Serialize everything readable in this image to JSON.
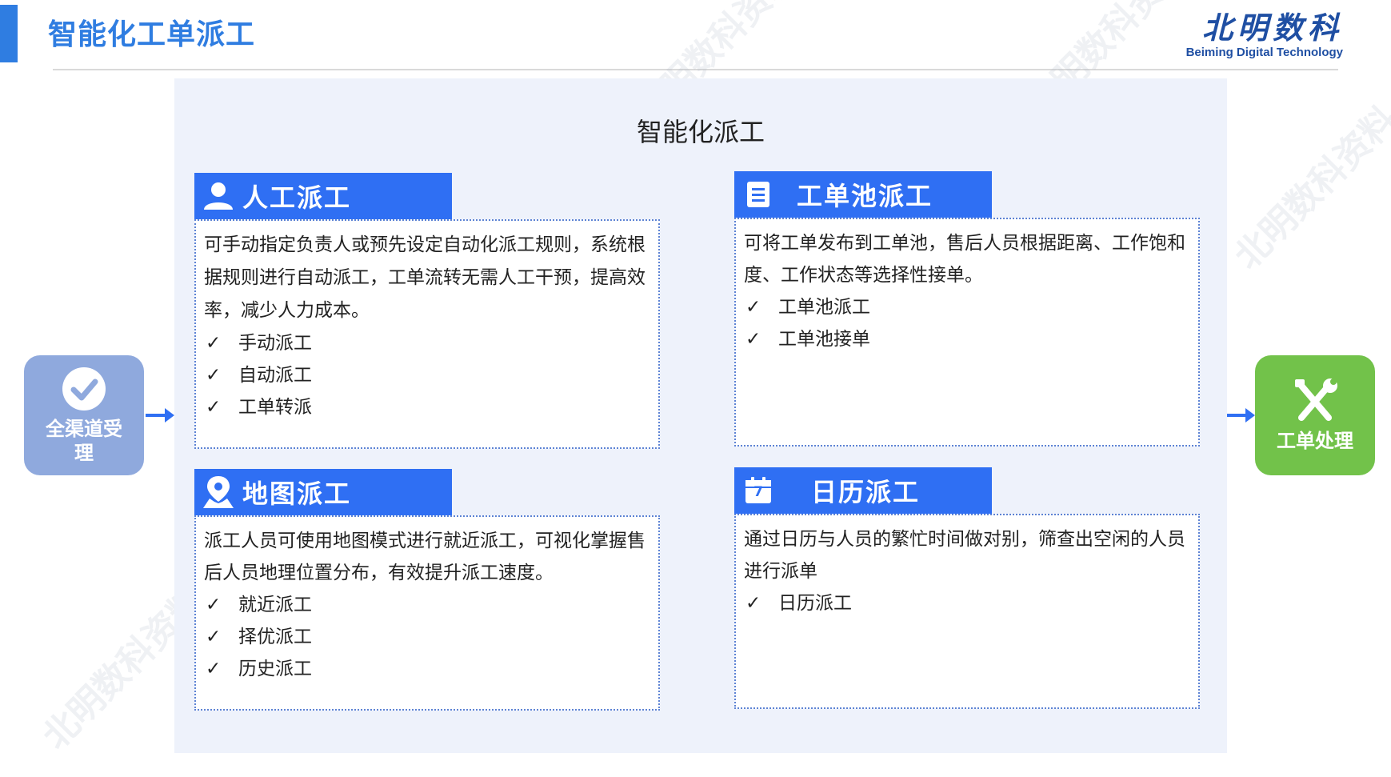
{
  "page": {
    "title": "智能化工单派工"
  },
  "logo": {
    "mark": "北明数科",
    "subtitle": "Beiming Digital Technology"
  },
  "panel": {
    "title": "智能化派工"
  },
  "left_node": {
    "label": "全渠道受理",
    "icon": "check-circle-icon",
    "color": "#8fa9dd"
  },
  "right_node": {
    "label": "工单处理",
    "icon": "wrench-screwdriver-icon",
    "color": "#72c24a"
  },
  "sections": {
    "manual": {
      "title": "人工派工",
      "icon": "person-icon",
      "description": "可手动指定负责人或预先设定自动化派工规则，系统根据规则进行自动派工，工单流转无需人工干预，提高效率，减少人力成本。",
      "items": [
        "手动派工",
        "自动派工",
        "工单转派"
      ]
    },
    "pool": {
      "title": "工单池派工",
      "icon": "document-icon",
      "description": "可将工单发布到工单池，售后人员根据距离、工作饱和度、工作状态等选择性接单。",
      "items": [
        "工单池派工",
        "工单池接单"
      ]
    },
    "map": {
      "title": "地图派工",
      "icon": "map-pin-person-icon",
      "description": "派工人员可使用地图模式进行就近派工，可视化掌握售后人员地理位置分布，有效提升派工速度。",
      "items": [
        "就近派工",
        "择优派工",
        "历史派工"
      ]
    },
    "calendar": {
      "title": "日历派工",
      "icon": "calendar-icon",
      "calendar_day": "7",
      "description": "通过日历与人员的繁忙时间做对别，筛查出空闲的人员进行派单",
      "items": [
        "日历派工"
      ]
    }
  },
  "check_mark": "✓",
  "watermark": "北明数科资料"
}
